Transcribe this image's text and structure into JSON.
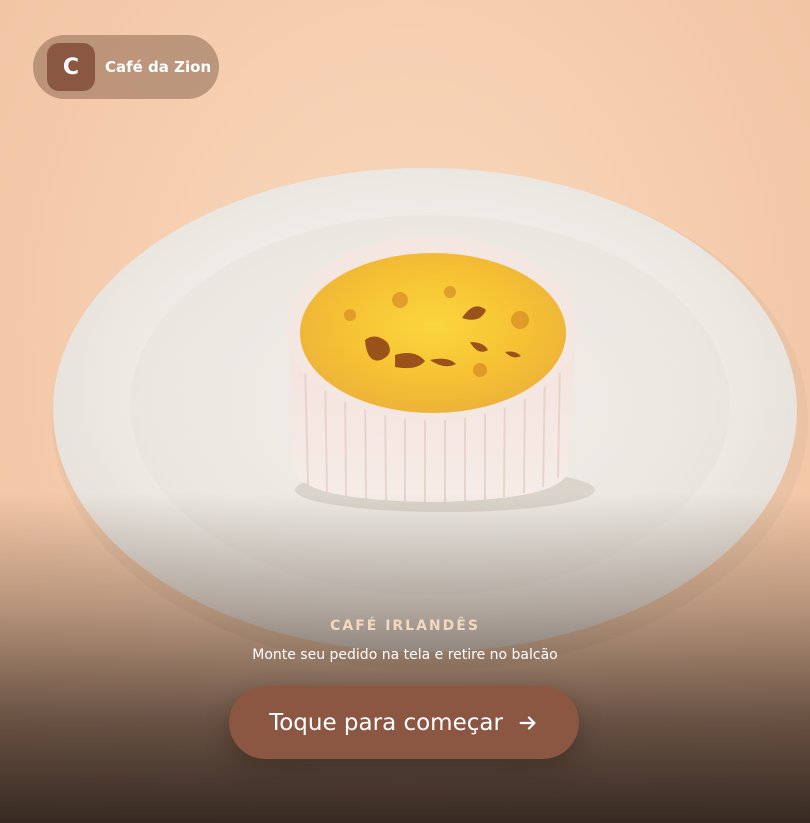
{
  "brand": {
    "initial": "C",
    "name": "Café da Zion"
  },
  "product": {
    "label": "CAFÉ IRLANDÊS",
    "subtitle": "Monte seu pedido na tela e retire no balcão"
  },
  "cta": {
    "label": "Toque para começar",
    "icon": "arrow-right-icon"
  },
  "colors": {
    "background": "#f6cfb0",
    "accent": "#8c5742",
    "brand_mark": "#8a5743",
    "label": "#f3d8bd"
  },
  "hero_image": {
    "icon": "dessert-plate-photo"
  }
}
